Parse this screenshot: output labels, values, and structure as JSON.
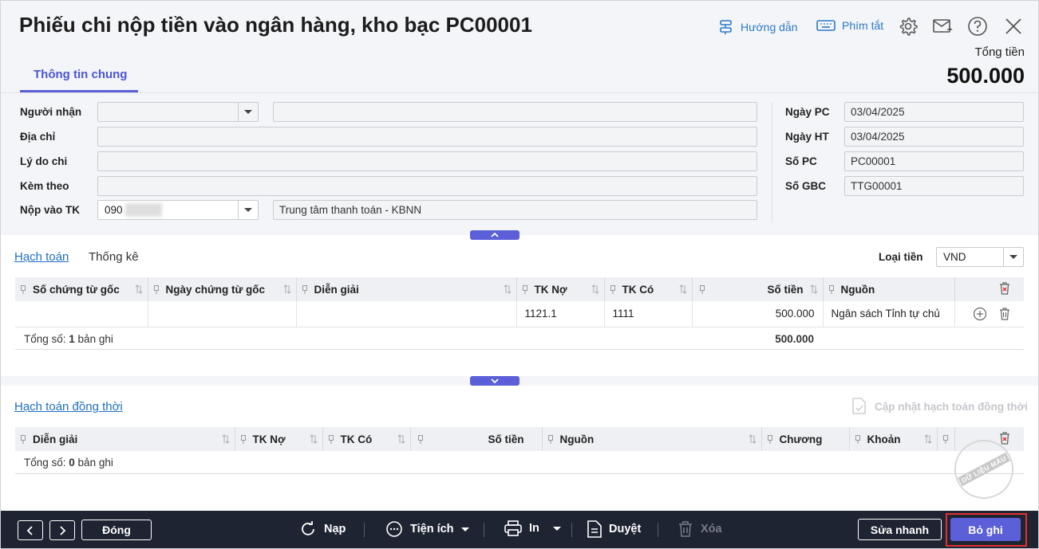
{
  "header": {
    "title": "Phiếu chi nộp tiền vào ngân hàng, kho bạc PC00001",
    "guide_label": "Hướng dẫn",
    "shortcuts_label": "Phím tắt",
    "total_label": "Tổng tiền",
    "total_value": "500.000"
  },
  "tabs": {
    "general": "Thông tin chung"
  },
  "form": {
    "recipient_label": "Người nhận",
    "recipient_value": "",
    "recipient_name": "",
    "address_label": "Địa chỉ",
    "address_value": "",
    "reason_label": "Lý do chi",
    "reason_value": "",
    "attachment_label": "Kèm theo",
    "attachment_value": "",
    "deposit_label": "Nộp vào TK",
    "deposit_account": "090",
    "deposit_bank": "Trung tâm thanh toán - KBNN",
    "date_pc_label": "Ngày PC",
    "date_pc_value": "03/04/2025",
    "date_ht_label": "Ngày HT",
    "date_ht_value": "03/04/2025",
    "so_pc_label": "Số PC",
    "so_pc_value": "PC00001",
    "so_gbc_label": "Số GBC",
    "so_gbc_value": "TTG00001"
  },
  "accounting": {
    "tab_accounting": "Hạch toán",
    "tab_stats": "Thống kê",
    "currency_label": "Loại tiền",
    "currency_value": "VND",
    "columns": [
      "Số chứng từ gốc",
      "Ngày chứng từ gốc",
      "Diễn giải",
      "TK Nợ",
      "TK Có",
      "Số tiền",
      "Nguồn"
    ],
    "rows": [
      {
        "doc_no": "",
        "doc_date": "",
        "description": "",
        "debit": "1121.1",
        "credit": "1111",
        "amount": "500.000",
        "source": "Ngân sách Tỉnh tự chủ"
      }
    ],
    "summary_prefix": "Tổng số: ",
    "summary_count": "1",
    "summary_suffix": " bản ghi",
    "summary_amount": "500.000"
  },
  "simultaneous": {
    "title": "Hạch toán đồng thời",
    "update_label": "Cập nhật hạch toán đồng thời",
    "columns": [
      "Diễn giải",
      "TK Nợ",
      "TK Có",
      "Số tiền",
      "Nguồn",
      "Chương",
      "Khoản"
    ],
    "summary_prefix": "Tổng số: ",
    "summary_count": "0",
    "summary_suffix": " bản ghi"
  },
  "watermark_text": "DỮ LIỆU MẪU",
  "footer": {
    "close_label": "Đóng",
    "reload_label": "Nạp",
    "utilities_label": "Tiện ích",
    "print_label": "In",
    "approve_label": "Duyệt",
    "delete_label": "Xóa",
    "quick_edit_label": "Sửa nhanh",
    "save_label": "Bỏ ghi"
  },
  "colors": {
    "accent": "#5b5fd8",
    "link": "#1f6fc0",
    "footer_bg": "#1f2433",
    "highlight": "#e0312f"
  }
}
